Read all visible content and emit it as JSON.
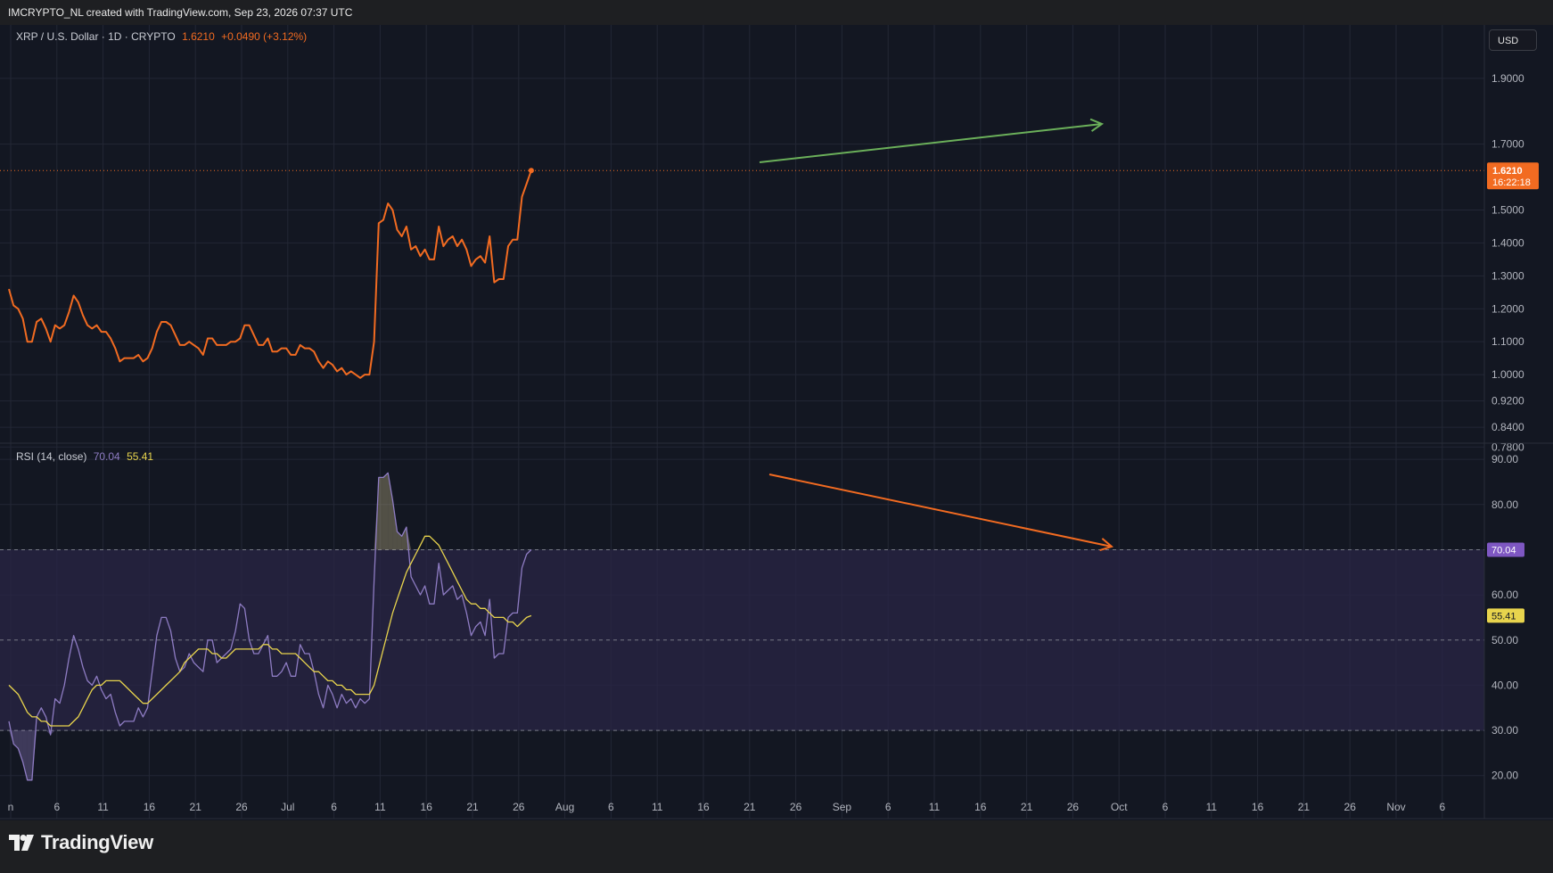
{
  "header": {
    "credit": "IMCRYPTO_NL created with TradingView.com, Sep 23, 2026 07:37 UTC",
    "currency_button": "USD"
  },
  "main_legend": {
    "symbol": "XRP / U.S. Dollar · 1D · CRYPTO",
    "price": "1.6210",
    "change": "+0.0490 (+3.12%)"
  },
  "rsi_legend": {
    "name": "RSI (14, close)",
    "rsi_value": "70.04",
    "ma_value": "55.41"
  },
  "price_badge": {
    "price": "1.6210",
    "countdown": "16:22:18"
  },
  "rsi_badge": "70.04",
  "ma_badge": "55.41",
  "footer": {
    "brand": "TradingView"
  },
  "colors": {
    "background": "#131722",
    "price_line": "#f26b21",
    "rsi_line": "#8e7cc3",
    "rsi_ma": "#e8d44d",
    "up_trend_arrow": "#6bb05a",
    "down_trend_arrow": "#f26b21",
    "rsi_band": "#2a2545"
  },
  "chart_data": [
    {
      "type": "line",
      "series": [
        {
          "values": [
            1.26,
            1.21,
            1.2,
            1.17,
            1.1,
            1.1,
            1.16,
            1.17,
            1.14,
            1.1,
            1.15,
            1.14,
            1.15,
            1.19,
            1.24,
            1.22,
            1.18,
            1.15,
            1.14,
            1.15,
            1.13,
            1.13,
            1.11,
            1.08,
            1.04,
            1.05,
            1.05,
            1.05,
            1.06,
            1.04,
            1.05,
            1.08,
            1.13,
            1.16,
            1.16,
            1.15,
            1.12,
            1.09,
            1.09,
            1.1,
            1.09,
            1.08,
            1.06,
            1.11,
            1.11,
            1.09,
            1.09,
            1.09,
            1.1,
            1.1,
            1.11,
            1.15,
            1.15,
            1.12,
            1.09,
            1.09,
            1.11,
            1.07,
            1.07,
            1.08,
            1.08,
            1.06,
            1.06,
            1.09,
            1.08,
            1.08,
            1.07,
            1.04,
            1.02,
            1.04,
            1.03,
            1.01,
            1.02,
            1.0,
            1.01,
            1.0,
            0.99,
            1.0,
            1.0,
            1.1,
            1.46,
            1.47,
            1.52,
            1.5,
            1.44,
            1.42,
            1.45,
            1.38,
            1.39,
            1.36,
            1.38,
            1.35,
            1.35,
            1.45,
            1.39,
            1.41,
            1.42,
            1.39,
            1.41,
            1.38,
            1.33,
            1.35,
            1.36,
            1.34,
            1.42,
            1.28,
            1.29,
            1.29,
            1.39,
            1.41,
            1.41,
            1.54,
            1.58,
            1.62
          ]
        }
      ],
      "ylim": [
        0.77,
        1.97
      ],
      "y_ticks": [
        "1.9000",
        "1.7000",
        "1.5000",
        "1.4000",
        "1.3000",
        "1.2000",
        "1.1000",
        "1.0000",
        "0.9200",
        "0.8400",
        "0.7800"
      ],
      "annotations": [
        "uptrend arrow on price highs"
      ]
    },
    {
      "type": "line",
      "title": "RSI (14, close)",
      "series": [
        {
          "values": [
            32,
            27,
            26,
            23,
            19,
            19,
            33,
            35,
            33,
            29,
            37,
            36,
            40,
            46,
            51,
            48,
            44,
            41,
            40,
            42,
            39,
            37,
            38,
            34,
            31,
            32,
            32,
            32,
            35,
            33,
            35,
            43,
            51,
            55,
            55,
            52,
            46,
            43,
            44,
            47,
            45,
            44,
            43,
            50,
            50,
            45,
            46,
            47,
            48,
            52,
            58,
            57,
            50,
            47,
            47,
            49,
            51,
            42,
            42,
            43,
            45,
            42,
            42,
            49,
            47,
            47,
            43,
            38,
            35,
            40,
            38,
            35,
            38,
            36,
            37,
            35,
            37,
            36,
            37,
            63,
            86,
            86,
            87,
            81,
            74,
            73,
            75,
            64,
            62,
            60,
            62,
            58,
            58,
            67,
            60,
            61,
            62,
            59,
            60,
            56,
            51,
            53,
            54,
            51,
            59,
            46,
            47,
            47,
            55,
            56,
            56,
            66,
            69,
            70
          ]
        },
        {
          "values": [
            40,
            39,
            38,
            36,
            34,
            33,
            33,
            32,
            32,
            31,
            31,
            31,
            31,
            31,
            32,
            33,
            35,
            37,
            39,
            40,
            40,
            41,
            41,
            41,
            41,
            40,
            39,
            38,
            37,
            36,
            36,
            37,
            38,
            39,
            40,
            41,
            42,
            43,
            45,
            46,
            47,
            48,
            48,
            48,
            47,
            47,
            46,
            46,
            47,
            48,
            48,
            48,
            48,
            48,
            48,
            49,
            49,
            48,
            48,
            47,
            47,
            47,
            47,
            46,
            45,
            44,
            43,
            43,
            42,
            41,
            41,
            40,
            40,
            39,
            39,
            38,
            38,
            38,
            38,
            40,
            44,
            48,
            52,
            56,
            59,
            62,
            65,
            67,
            69,
            71,
            73,
            73,
            72,
            71,
            69,
            67,
            65,
            63,
            61,
            59,
            58,
            58,
            57,
            57,
            56,
            55,
            55,
            55,
            54,
            54,
            53,
            54,
            55,
            55.41
          ]
        }
      ],
      "ylim": [
        16,
        92
      ],
      "y_ticks": [
        "90.00",
        "80.00",
        "70.00",
        "60.00",
        "50.00",
        "40.00",
        "30.00",
        "20.00"
      ],
      "bands": {
        "upper": 70,
        "middle": 50,
        "lower": 30
      },
      "annotations": [
        "downtrend arrow on RSI highs"
      ]
    }
  ],
  "x_axis": {
    "tick_labels": [
      "n",
      "6",
      "11",
      "16",
      "21",
      "26",
      "Jul",
      "6",
      "11",
      "16",
      "21",
      "26",
      "Aug",
      "6",
      "11",
      "16",
      "21",
      "26",
      "Sep",
      "6",
      "11",
      "16",
      "21",
      "26",
      "Oct",
      "6",
      "11",
      "16",
      "21",
      "26",
      "Nov",
      "6"
    ]
  }
}
